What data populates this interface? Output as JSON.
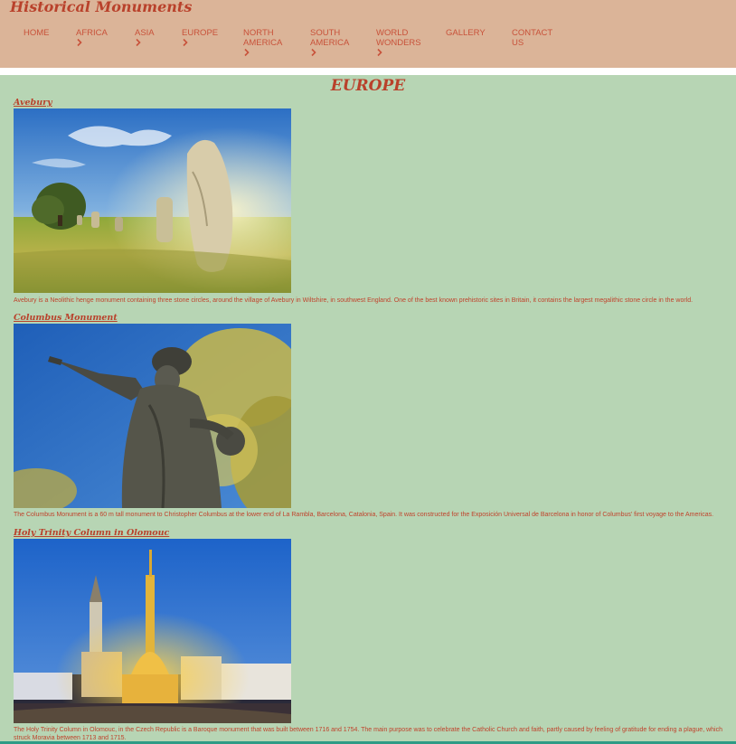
{
  "site": {
    "logo": "Historical Monuments"
  },
  "nav": [
    {
      "line1": "HOME",
      "line2": "",
      "chevron": false
    },
    {
      "line1": "AFRICA",
      "line2": "",
      "chevron": true
    },
    {
      "line1": "ASIA",
      "line2": "",
      "chevron": true
    },
    {
      "line1": "EUROPE",
      "line2": "",
      "chevron": true
    },
    {
      "line1": "NORTH",
      "line2": "AMERICA",
      "chevron": true
    },
    {
      "line1": "SOUTH",
      "line2": "AMERICA",
      "chevron": true
    },
    {
      "line1": "WORLD",
      "line2": "WONDERS",
      "chevron": true
    },
    {
      "line1": "GALLERY",
      "line2": "",
      "chevron": false
    },
    {
      "line1": "CONTACT",
      "line2": "US",
      "chevron": false
    }
  ],
  "page": {
    "title": "EUROPE"
  },
  "monuments": [
    {
      "title": "Avebury",
      "image": "avebury-standing-stones-photo",
      "description": "Avebury is a Neolithic henge monument containing three stone circles, around the village of Avebury in Wiltshire, in southwest England. One of the best known prehistoric sites in Britain, it contains the largest megalithic stone circle in the world."
    },
    {
      "title": "Columbus Monument",
      "image": "columbus-statue-photo",
      "description": "The Columbus Monument is a 60 m tall monument to Christopher Columbus at the lower end of La Rambla, Barcelona, Catalonia, Spain. It was constructed for the Exposición Universal de Barcelona in honor of Columbus' first voyage to the Americas."
    },
    {
      "title": "Holy Trinity Column in Olomouc",
      "image": "olomouc-column-night-photo",
      "description": "The Holy Trinity Column in Olomouc, in the Czech Republic is a Baroque monument that was built between 1716 and 1754. The main purpose was to celebrate the Catholic Church and faith, partly caused by feeling of gratitude for ending a plague, which struck Moravia between 1713 and 1715."
    }
  ],
  "colors": {
    "header": "#dbb498",
    "background": "#b7d5b4",
    "accent": "#b9412b",
    "bottom_bar": "#2e9b86"
  }
}
